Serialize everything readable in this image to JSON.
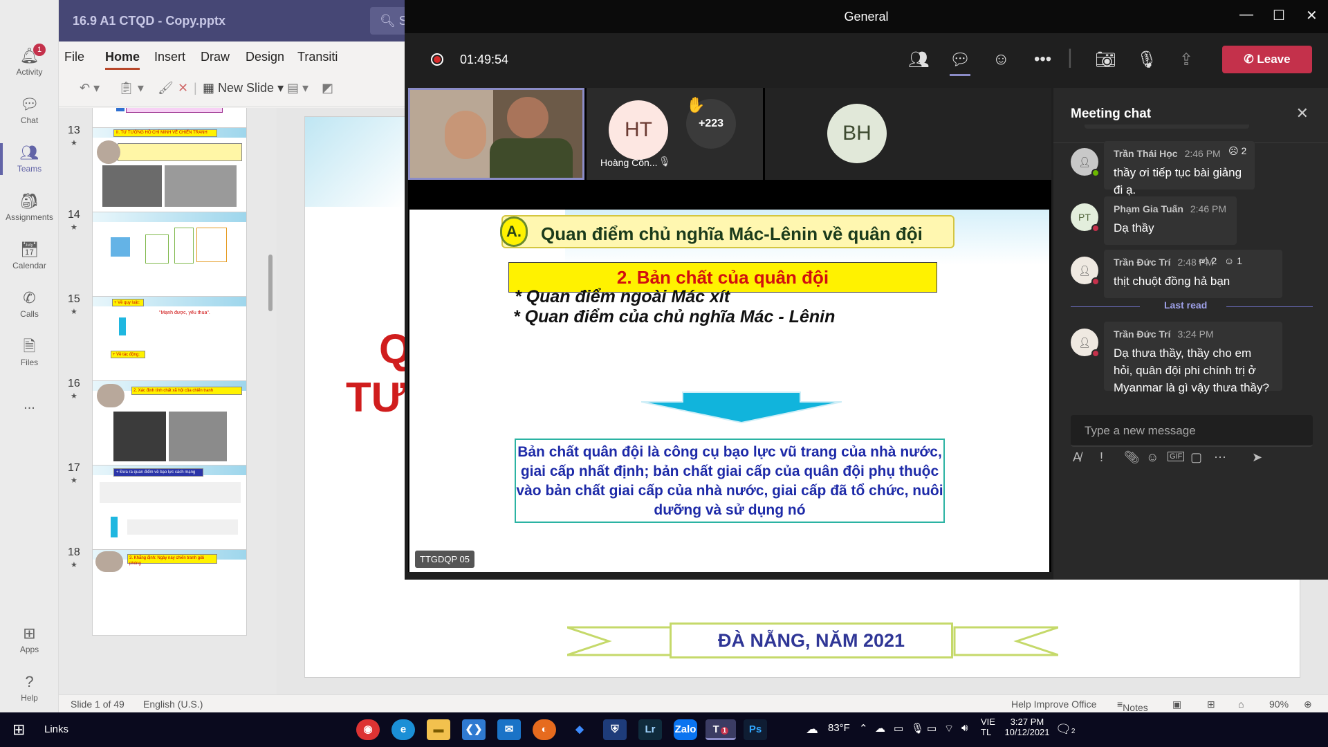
{
  "ppt": {
    "file_name": "16.9 A1 CTQD - Copy.pptx",
    "search_glyph": "S",
    "tabs": [
      "File",
      "Home",
      "Insert",
      "Draw",
      "Design",
      "Transiti"
    ],
    "new_slide": "New Slide",
    "thumb_numbers": [
      "13",
      "14",
      "15",
      "16",
      "17",
      "18"
    ],
    "thumbs": {
      "t13_title": "II. TƯ TƯỞNG HỒ CHÍ MINH VỀ CHIẾN TRANH",
      "t15_a": "+ Về quy luật:",
      "t15_b": "\"Mạnh được, yếu thua\".",
      "t15_c": "+ Về tác động:",
      "t16_title": "2. Xác định tính chất xã hội của chiến tranh",
      "t17_title": "+ Đưa ra quan điểm về bạo lực cách mạng",
      "t18_title": "3. Khẳng định: Ngày nay chiến tranh giải phóng"
    },
    "slide_big_text_1": "Q",
    "slide_big_text_2": "TƯ",
    "banner": "ĐÀ NẴNG, NĂM 2021",
    "status": {
      "slide": "Slide 1 of 49",
      "lang": "English (U.S.)",
      "help": "Help Improve Office",
      "notes": "Notes",
      "zoom": "90%"
    }
  },
  "rail": {
    "activity": "Activity",
    "activity_badge": "1",
    "chat": "Chat",
    "teams": "Teams",
    "assignments": "Assignments",
    "calendar": "Calendar",
    "calls": "Calls",
    "files": "Files",
    "more": "...",
    "apps": "Apps",
    "help": "Help"
  },
  "meeting": {
    "window_title": "General",
    "timer": "01:49:54",
    "leave": "Leave",
    "participants": [
      {
        "initials": "HT",
        "name": "Hoàng Côn..."
      },
      {
        "initials": "+223"
      },
      {
        "initials": "BH"
      }
    ],
    "shared_slide": {
      "header_letter": "A.",
      "header": "Quan điểm chủ nghĩa Mác-Lênin về quân đội",
      "subheader": "2. Bản chất của quân đội",
      "bullet_1": "* Quan điểm ngoài Mác xít",
      "bullet_2": "* Quan điểm của chủ nghĩa Mác - Lênin",
      "definition": "Bản chất quân đội là công cụ bạo lực vũ trang của nhà nước, giai cấp nhất định; bản chất giai cấp của quân đội phụ thuộc vào bản chất giai cấp của nhà nước, giai cấp đã tổ chức, nuôi dưỡng và sử dụng nó",
      "label": "TTGDQP 05"
    }
  },
  "chat": {
    "title": "Meeting chat",
    "messages": [
      {
        "name": "Trần Thái Học",
        "time": "2:46 PM",
        "text": "thầy ơi tiếp tục bài giảng đi ạ.",
        "reaction": "2"
      },
      {
        "name": "Phạm Gia Tuấn",
        "initials": "PT",
        "time": "2:46 PM",
        "text": "Dạ thầy"
      },
      {
        "name": "Trần Đức Trí",
        "time": "2:48 PM",
        "text": "thịt chuột đồng hả bạn",
        "reaction_like": "2",
        "reaction_laugh": "1"
      },
      {
        "name": "Trần Đức Trí",
        "time": "3:24 PM",
        "text": "Dạ thưa thầy, thầy cho em hỏi, quân đội phi chính trị ở Myanmar là gì vậy thưa thầy?"
      }
    ],
    "last_read": "Last read",
    "placeholder": "Type a new message"
  },
  "taskbar": {
    "links": "Links",
    "temp": "83°F",
    "lang1": "VIE",
    "lang2": "TL",
    "time": "3:27 PM",
    "date": "10/12/2021",
    "notif": "2"
  },
  "colors": {
    "teams_purple": "#6264a7",
    "leave_red": "#c4314b",
    "ppt_title": "#464775"
  }
}
